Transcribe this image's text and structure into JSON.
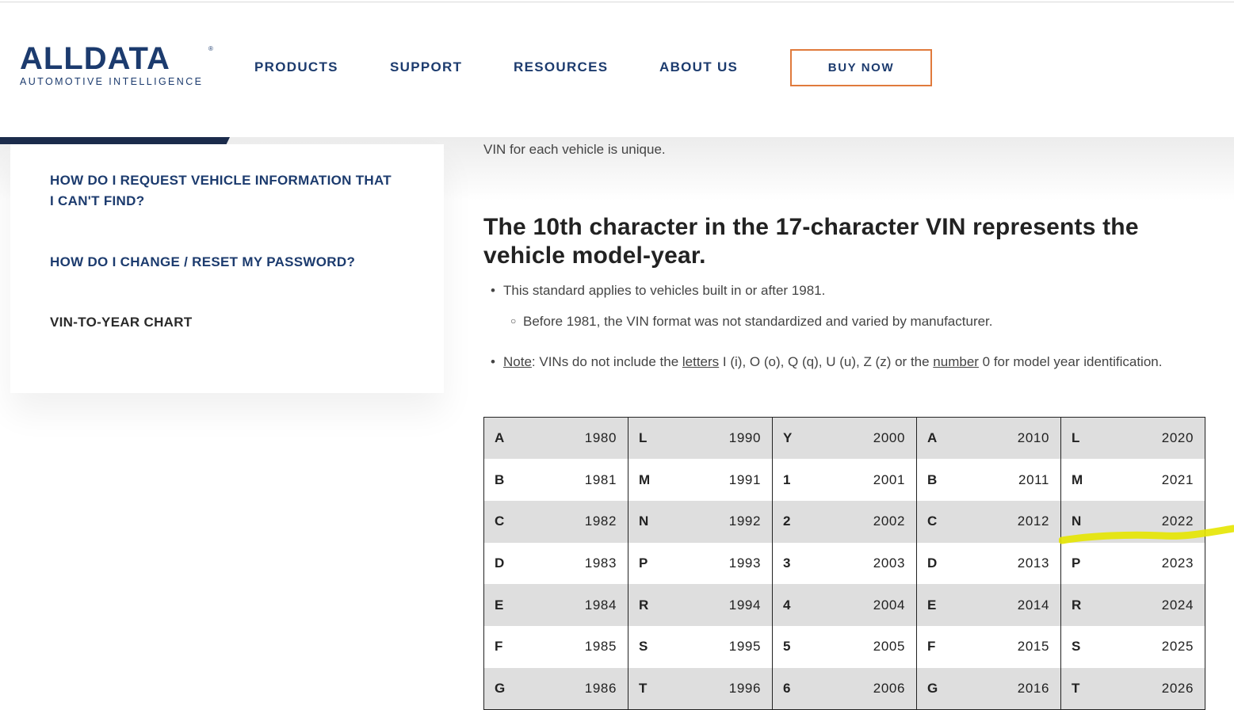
{
  "brand": {
    "name": "ALLDATA",
    "registered": "®",
    "tagline": "AUTOMOTIVE INTELLIGENCE"
  },
  "nav": {
    "items": [
      "PRODUCTS",
      "SUPPORT",
      "RESOURCES",
      "ABOUT US"
    ],
    "cta": "BUY NOW"
  },
  "sidebar": {
    "links": [
      "HOW DO I REQUEST VEHICLE INFORMATION THAT I CAN'T FIND?",
      "HOW DO I CHANGE / RESET MY PASSWORD?",
      "VIN-TO-YEAR CHART"
    ],
    "active_index": 2
  },
  "content": {
    "intro": "VIN for each vehicle is unique.",
    "headline": "The 10th character in the 17-character VIN represents the vehicle model-year.",
    "bullet1": "This standard applies to vehicles built in or after 1981.",
    "subbullet1": "Before 1981, the VIN format was not standardized and varied by manufacturer.",
    "note": {
      "label": "Note",
      "text_before_letters": ": VINs do not include the ",
      "letters_link": "letters",
      "text_middle": " I (i), O (o), Q (q), U (u), Z (z) or the ",
      "number_link": "number",
      "text_after": " 0 for model year identification."
    }
  },
  "vin_table": {
    "rows": [
      [
        [
          "A",
          "1980"
        ],
        [
          "L",
          "1990"
        ],
        [
          "Y",
          "2000"
        ],
        [
          "A",
          "2010"
        ],
        [
          "L",
          "2020"
        ]
      ],
      [
        [
          "B",
          "1981"
        ],
        [
          "M",
          "1991"
        ],
        [
          "1",
          "2001"
        ],
        [
          "B",
          "2011"
        ],
        [
          "M",
          "2021"
        ]
      ],
      [
        [
          "C",
          "1982"
        ],
        [
          "N",
          "1992"
        ],
        [
          "2",
          "2002"
        ],
        [
          "C",
          "2012"
        ],
        [
          "N",
          "2022"
        ]
      ],
      [
        [
          "D",
          "1983"
        ],
        [
          "P",
          "1993"
        ],
        [
          "3",
          "2003"
        ],
        [
          "D",
          "2013"
        ],
        [
          "P",
          "2023"
        ]
      ],
      [
        [
          "E",
          "1984"
        ],
        [
          "R",
          "1994"
        ],
        [
          "4",
          "2004"
        ],
        [
          "E",
          "2014"
        ],
        [
          "R",
          "2024"
        ]
      ],
      [
        [
          "F",
          "1985"
        ],
        [
          "S",
          "1995"
        ],
        [
          "5",
          "2005"
        ],
        [
          "F",
          "2015"
        ],
        [
          "S",
          "2025"
        ]
      ],
      [
        [
          "G",
          "1986"
        ],
        [
          "T",
          "1996"
        ],
        [
          "6",
          "2006"
        ],
        [
          "G",
          "2016"
        ],
        [
          "T",
          "2026"
        ]
      ]
    ]
  },
  "colors": {
    "brand_navy": "#1c3b6e",
    "cta_border": "#e07a3c",
    "highlight_marker": "#e6e600",
    "table_stripe": "#dedede"
  }
}
